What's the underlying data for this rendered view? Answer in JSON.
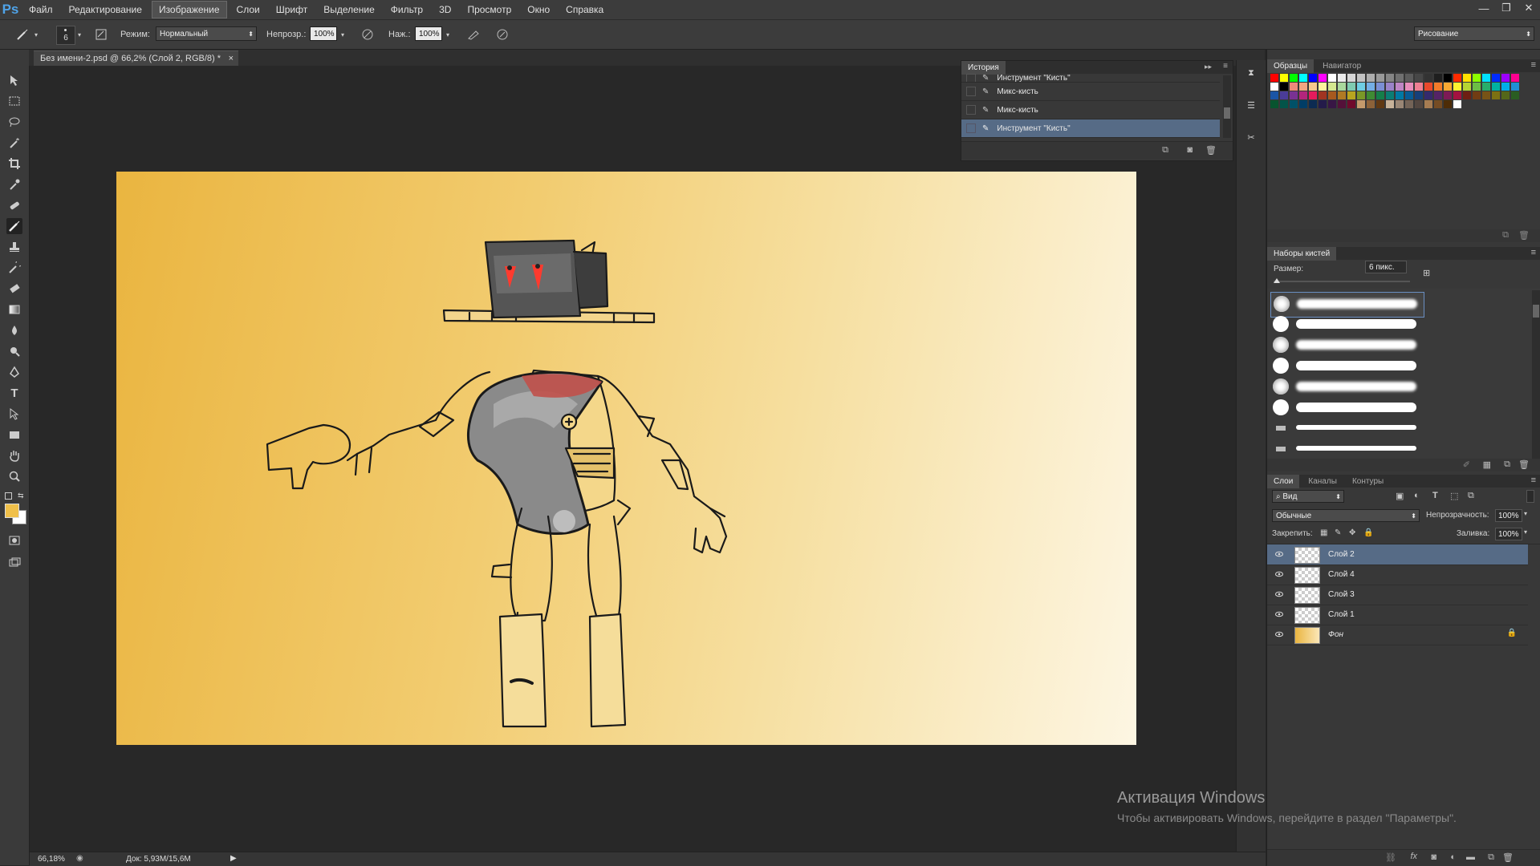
{
  "app": {
    "logo": "Ps"
  },
  "menu": [
    "Файл",
    "Редактирование",
    "Изображение",
    "Слои",
    "Шрифт",
    "Выделение",
    "Фильтр",
    "3D",
    "Просмотр",
    "Окно",
    "Справка"
  ],
  "menu_active": "Изображение",
  "options": {
    "brush_size": "6",
    "mode_label": "Режим:",
    "mode_value": "Нормальный",
    "opacity_label": "Непрозр.:",
    "opacity_value": "100%",
    "pressure_label": "Наж.:",
    "pressure_value": "100%",
    "workspace": "Рисование"
  },
  "document_tab": {
    "title": "Без имени-2.psd @ 66,2% (Слой 2, RGB/8) *",
    "close": "×"
  },
  "history": {
    "tab": "История",
    "items": [
      {
        "label": "Инструмент \"Кисть\"",
        "partial": true
      },
      {
        "label": "Микс-кисть"
      },
      {
        "label": "Микс-кисть"
      },
      {
        "label": "Инструмент \"Кисть\"",
        "selected": true
      }
    ]
  },
  "swatches": {
    "tab_active": "Образцы",
    "tab_inactive": "Навигатор"
  },
  "brush_presets": {
    "title": "Наборы кистей",
    "size_label": "Размер:",
    "size_value": "6 пикс."
  },
  "layers": {
    "tabs": [
      "Слои",
      "Каналы",
      "Контуры"
    ],
    "filter": "Вид",
    "blend": "Обычные",
    "opacity_label": "Непрозрачность:",
    "opacity_value": "100%",
    "lock_label": "Закрепить:",
    "fill_label": "Заливка:",
    "fill_value": "100%",
    "items": [
      {
        "name": "Слой 2",
        "selected": true
      },
      {
        "name": "Слой 4"
      },
      {
        "name": "Слой 3"
      },
      {
        "name": "Слой 1"
      },
      {
        "name": "Фон",
        "locked": true
      }
    ]
  },
  "status": {
    "zoom": "66,18%",
    "doc": "Док: 5,93M/15,6M"
  },
  "watermark": {
    "line1": "Активация Windows",
    "line2": "Чтобы активировать Windows, перейдите в раздел \"Параметры\"."
  },
  "colors": {
    "foreground": "#f0c04a",
    "background": "#ffffff",
    "selection": "#566b86"
  }
}
